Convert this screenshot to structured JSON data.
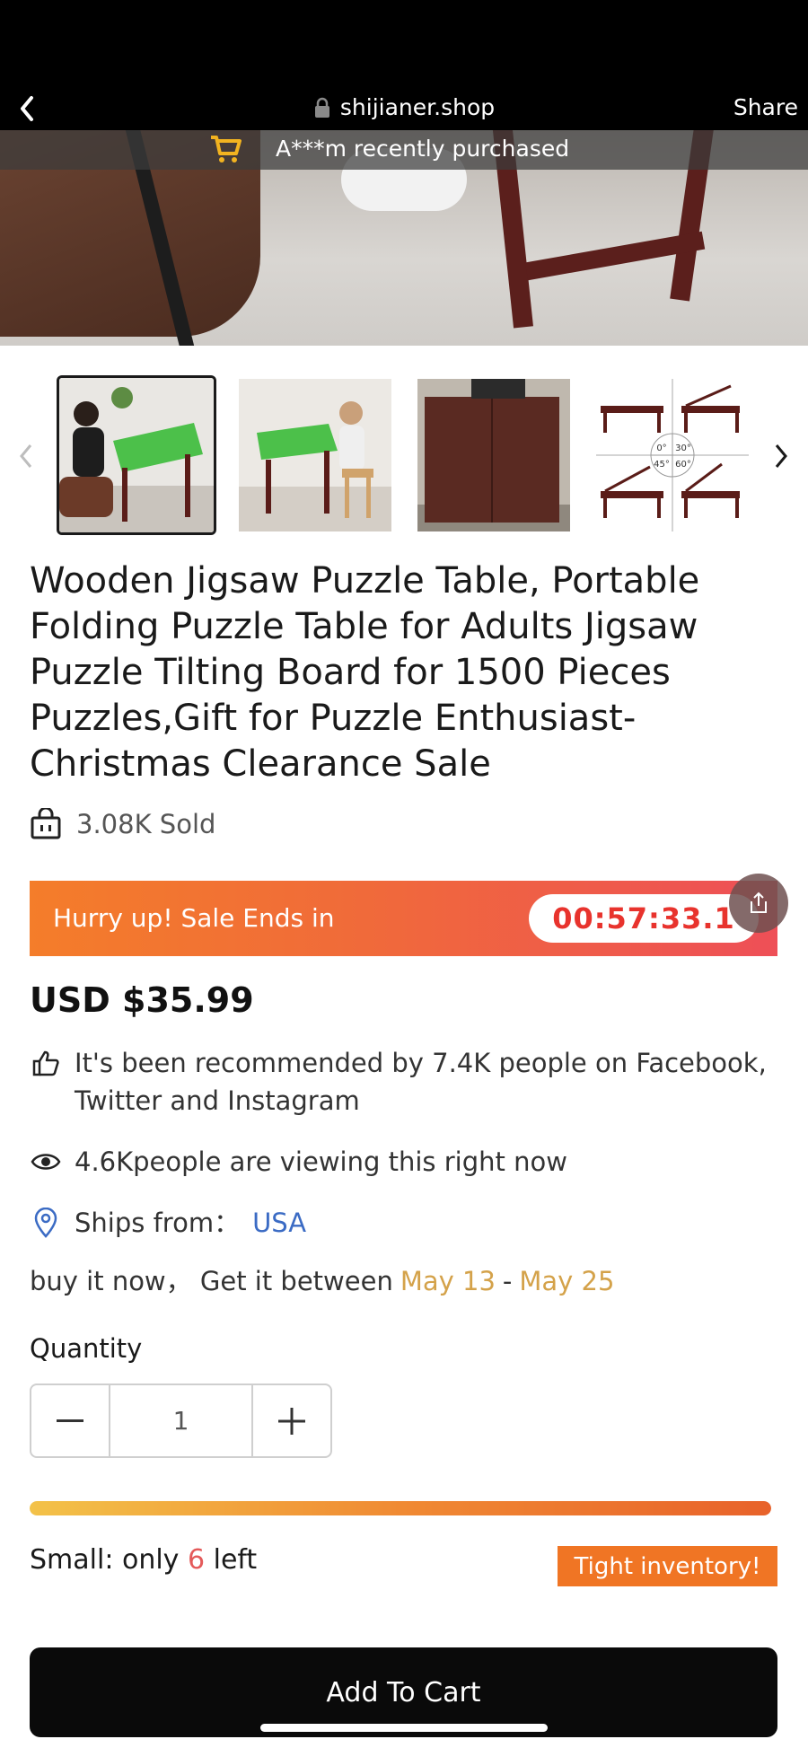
{
  "browser": {
    "url": "shijianer.shop",
    "share_label": "Share"
  },
  "banner": {
    "text": "A***m   recently purchased"
  },
  "product": {
    "title": "Wooden Jigsaw Puzzle Table, Portable Folding Puzzle Table for Adults Jigsaw Puzzle Tilting Board for 1500 Pieces Puzzles,Gift for Puzzle Enthusiast-Christmas Clearance Sale",
    "sold": "3.08K Sold",
    "price": "USD $35.99"
  },
  "thumbnails": {
    "angle_labels": [
      "0°",
      "30°",
      "45°",
      "60°"
    ]
  },
  "sale": {
    "label": "Hurry up! Sale Ends in",
    "timer": "00:57:33.1"
  },
  "info": {
    "recommended": "It's been recommended by 7.4K people on Facebook, Twitter and Instagram",
    "viewing": "4.6Kpeople are viewing this right now",
    "ships_label": "Ships from：",
    "ships_value": "USA",
    "delivery_prefix": "buy it now， Get it between",
    "delivery_start": "May 13",
    "delivery_sep": "-",
    "delivery_end": "May 25"
  },
  "quantity": {
    "label": "Quantity",
    "value": "1"
  },
  "stock": {
    "level": 1.0,
    "prefix": "Small: only",
    "count": "6",
    "suffix": "left",
    "badge": "Tight inventory!"
  },
  "cart": {
    "label": "Add To Cart"
  },
  "colors": {
    "sale_gradient_start": "#f47d2a",
    "sale_gradient_end": "#ee4f57",
    "timer_red": "#e8332d",
    "link_blue": "#3b6bc4",
    "date_gold": "#d4a24a",
    "badge_orange": "#f07524"
  }
}
